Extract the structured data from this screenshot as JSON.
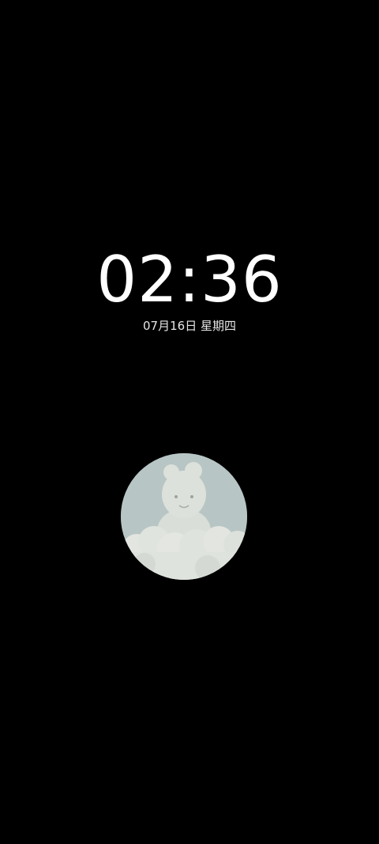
{
  "lockscreen": {
    "time": "02:36",
    "date": "07月16日 星期四"
  },
  "avatar": {
    "icon": "cloud-bear-avatar-icon",
    "colors": {
      "sky": "#b7c5c4",
      "cloud": "#dfe3de",
      "cloud_shadow": "#c9d0cb"
    }
  }
}
